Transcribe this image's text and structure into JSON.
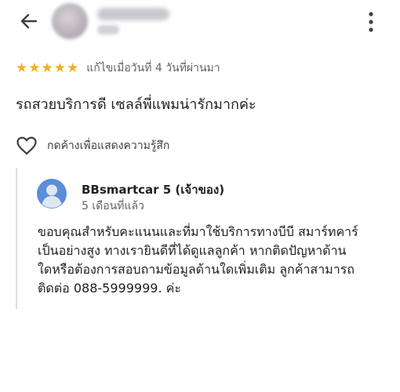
{
  "header": {
    "back_icon": "arrow-left-icon",
    "more_icon": "more-vertical-icon"
  },
  "review": {
    "stars": 5,
    "star_color": "#f2b01e",
    "edited_label": "แก้ไขเมื่อวันที่ 4 วันที่ผ่านมา",
    "text": "รถสวยบริการดี เซลล์พี่แพมน่ารักมากค่ะ",
    "like_label": "กดค้างเพื่อแสดงความรู้สึก"
  },
  "reply": {
    "owner_name": "BBsmartcar 5 (เจ้าของ)",
    "time": "5 เดือนที่แล้ว",
    "lines": [
      "ขอบคุณสำหรับคะแนนและที่มาใช้บริการทางบีบี สมาร์ทคาร์",
      "เป็นอย่างสูง ทางเรายินดีที่ได้ดูแลลูกค้า หากติดปัญหาด้าน",
      "ใดหรือต้องการสอบถามข้อมูลด้านใดเพิ่มเติม ลูกค้าสามารถ",
      "ติดต่อ 088-5999999. ค่ะ"
    ],
    "avatar_color": "#5b8dd9"
  }
}
